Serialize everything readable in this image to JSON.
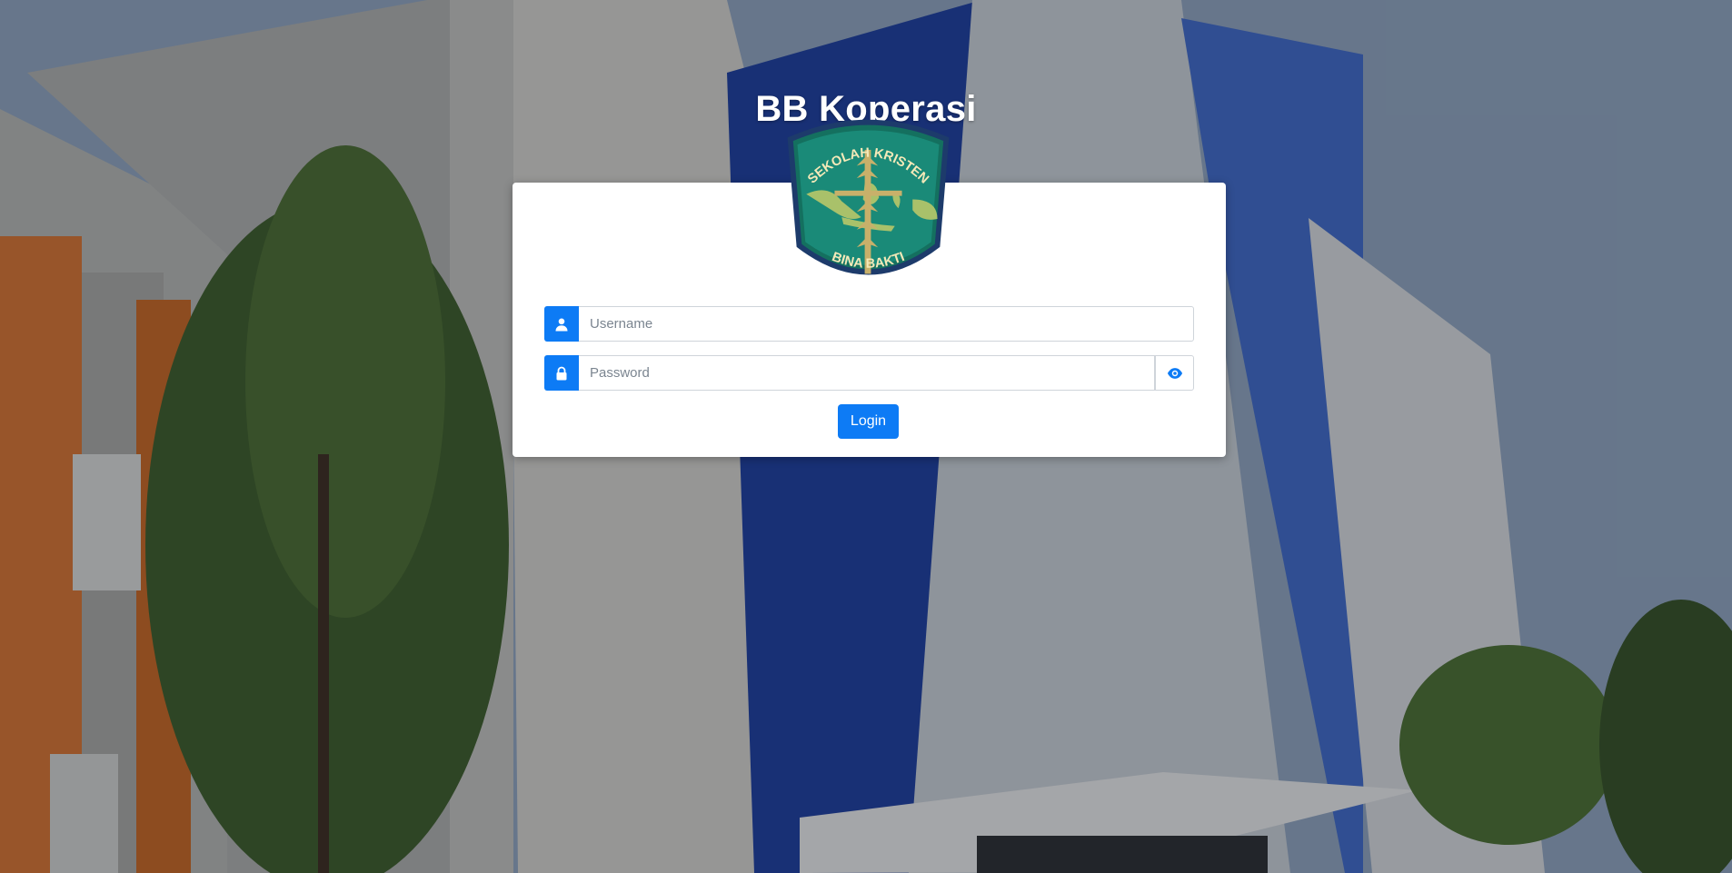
{
  "app": {
    "title": "BB Koperasi"
  },
  "logo": {
    "top_text": "SEKOLAH KRISTEN",
    "bottom_text": "BINA BAKTI"
  },
  "login_form": {
    "username_placeholder": "Username",
    "password_placeholder": "Password",
    "login_label": "Login",
    "icons": {
      "username": "user-icon",
      "password": "lock-icon",
      "toggle": "eye-icon"
    }
  },
  "colors": {
    "primary": "#0d7bf5",
    "logo_green": "#1a8a78",
    "logo_gold": "#c8b06a"
  }
}
